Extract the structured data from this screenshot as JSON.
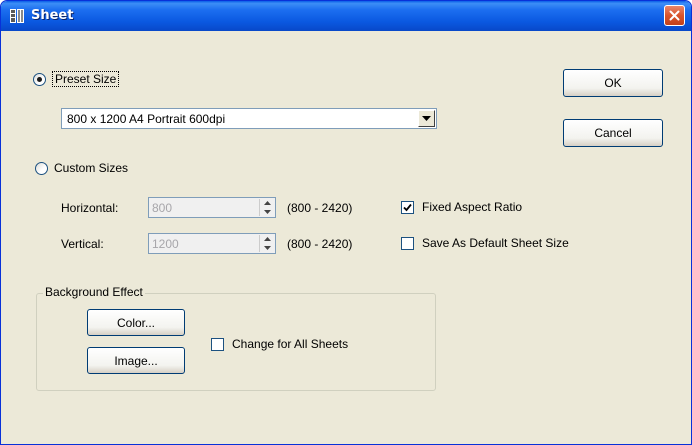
{
  "window": {
    "title": "Sheet"
  },
  "preset": {
    "label": "Preset Size",
    "selected": "800 x 1200 A4 Portrait 600dpi"
  },
  "custom": {
    "label": "Custom Sizes"
  },
  "horizontal": {
    "label": "Horizontal:",
    "value": "800",
    "range": "(800 - 2420)"
  },
  "vertical": {
    "label": "Vertical:",
    "value": "1200",
    "range": "(800 - 2420)"
  },
  "fixed_aspect": {
    "label": "Fixed Aspect Ratio",
    "checked": true
  },
  "save_default": {
    "label": "Save As Default Sheet Size",
    "checked": false
  },
  "background": {
    "title": "Background Effect",
    "color_label": "Color...",
    "image_label": "Image...",
    "change_all_label": "Change for All Sheets",
    "change_all_checked": false
  },
  "buttons": {
    "ok": "OK",
    "cancel": "Cancel"
  },
  "colors": {
    "title_bar": "#0a58e0",
    "face": "#ece9d8",
    "border": "#7f9db9"
  },
  "icons": {
    "title": "sheet-app-icon",
    "close": "close-icon",
    "dropdown": "chevron-down-icon",
    "spin": "spin-arrows-icon"
  }
}
